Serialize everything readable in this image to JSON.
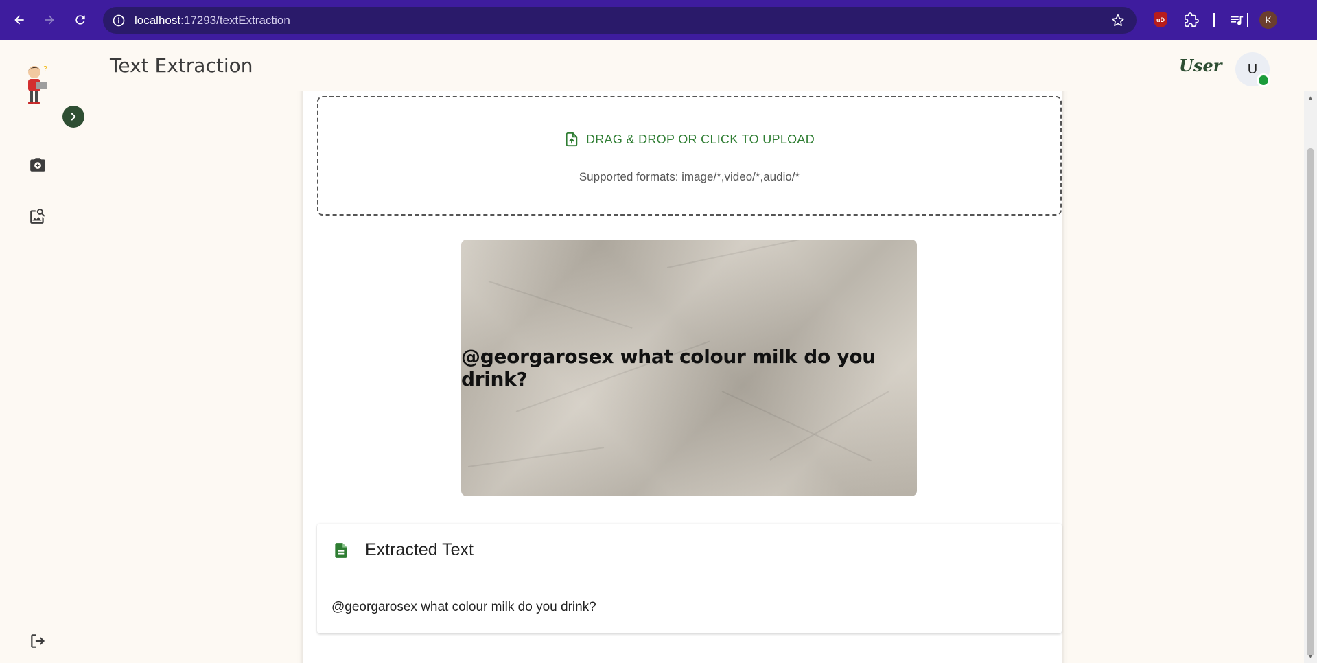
{
  "browser": {
    "url_host": "localhost",
    "url_path": ":17293/textExtraction",
    "profile_initial": "K",
    "ublock_label": "uD"
  },
  "header": {
    "title": "Text Extraction",
    "brand": "User",
    "avatar_initial": "U"
  },
  "upload": {
    "label": "DRAG & DROP OR CLICK TO UPLOAD",
    "formats": "Supported formats: image/*,video/*,audio/*"
  },
  "preview": {
    "image_text": "@georgarosex what colour milk do you drink?"
  },
  "result": {
    "title": "Extracted Text",
    "text": "@georgarosex what colour milk do you drink?"
  },
  "colors": {
    "browser_bar": "#3e1c9e",
    "accent_green": "#2e7d32",
    "status_online": "#1b9c3b"
  }
}
